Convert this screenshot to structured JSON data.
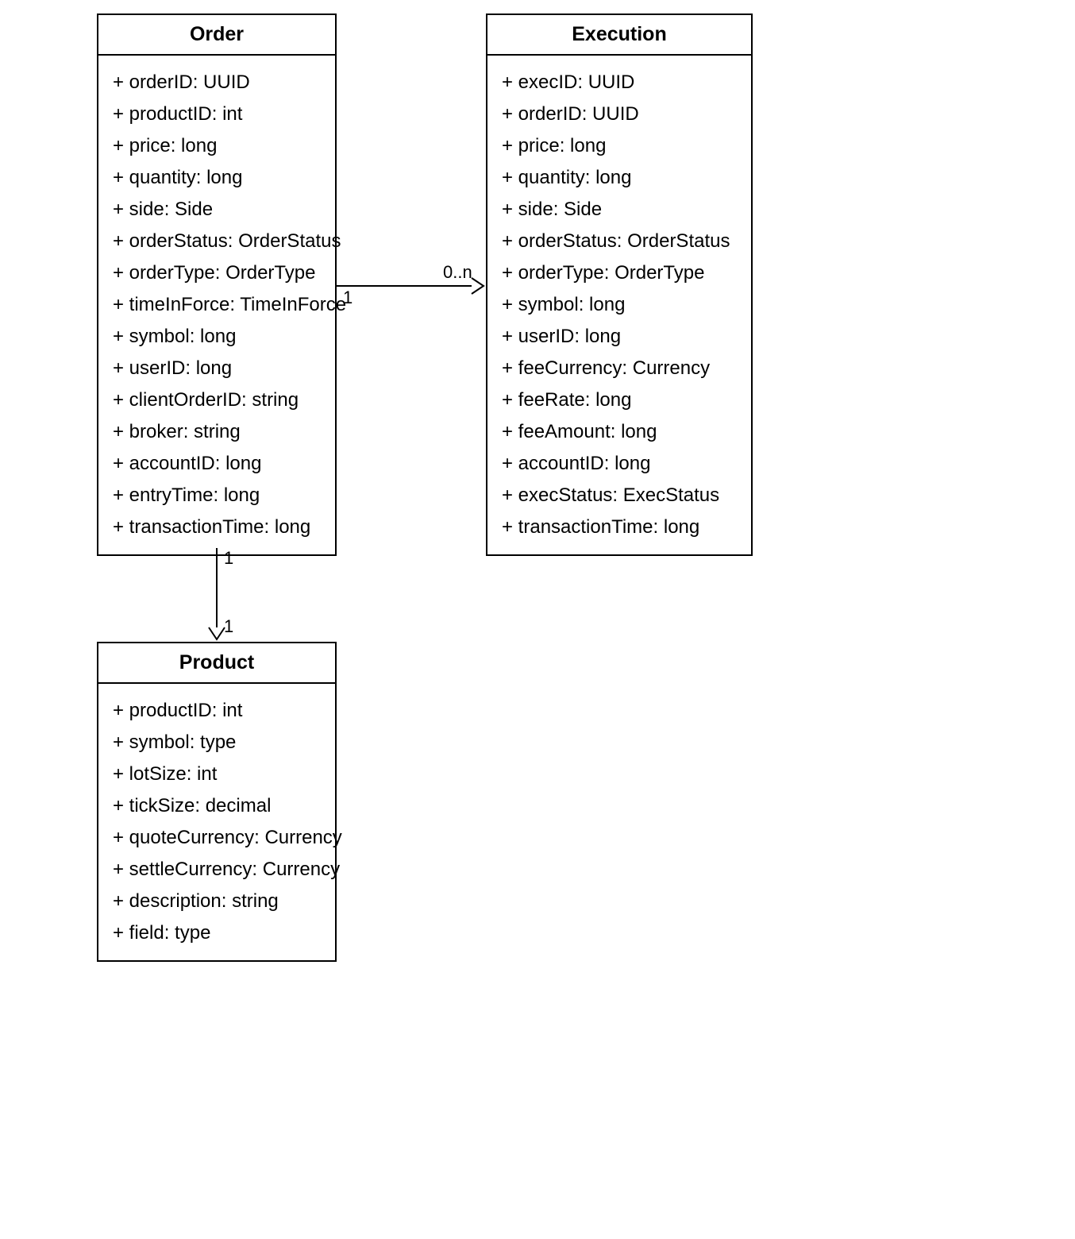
{
  "classes": {
    "order": {
      "title": "Order",
      "attrs": [
        "+ orderID: UUID",
        "+ productID: int",
        "+ price: long",
        "+ quantity: long",
        "+ side: Side",
        "+ orderStatus: OrderStatus",
        "+ orderType: OrderType",
        "+ timeInForce: TimeInForce",
        "+ symbol: long",
        "+ userID: long",
        "+ clientOrderID: string",
        "+ broker: string",
        "+ accountID: long",
        "+ entryTime: long",
        "+ transactionTime: long"
      ]
    },
    "execution": {
      "title": "Execution",
      "attrs": [
        "+ execID: UUID",
        "+ orderID: UUID",
        "+ price: long",
        "+ quantity: long",
        "+ side: Side",
        "+ orderStatus: OrderStatus",
        "+ orderType: OrderType",
        "+ symbol: long",
        "+ userID: long",
        "+ feeCurrency: Currency",
        "+ feeRate: long",
        "+ feeAmount: long",
        "+ accountID: long",
        "+ execStatus: ExecStatus",
        "+ transactionTime: long"
      ]
    },
    "product": {
      "title": "Product",
      "attrs": [
        "+ productID: int",
        "+ symbol: type",
        "+ lotSize: int",
        "+ tickSize: decimal",
        "+ quoteCurrency: Currency",
        "+ settleCurrency: Currency",
        "+ description: string",
        "+ field: type"
      ]
    }
  },
  "multiplicities": {
    "order_to_execution_left": "1",
    "order_to_execution_right": "0..n",
    "order_to_product_top": "1",
    "order_to_product_bottom": "1"
  }
}
